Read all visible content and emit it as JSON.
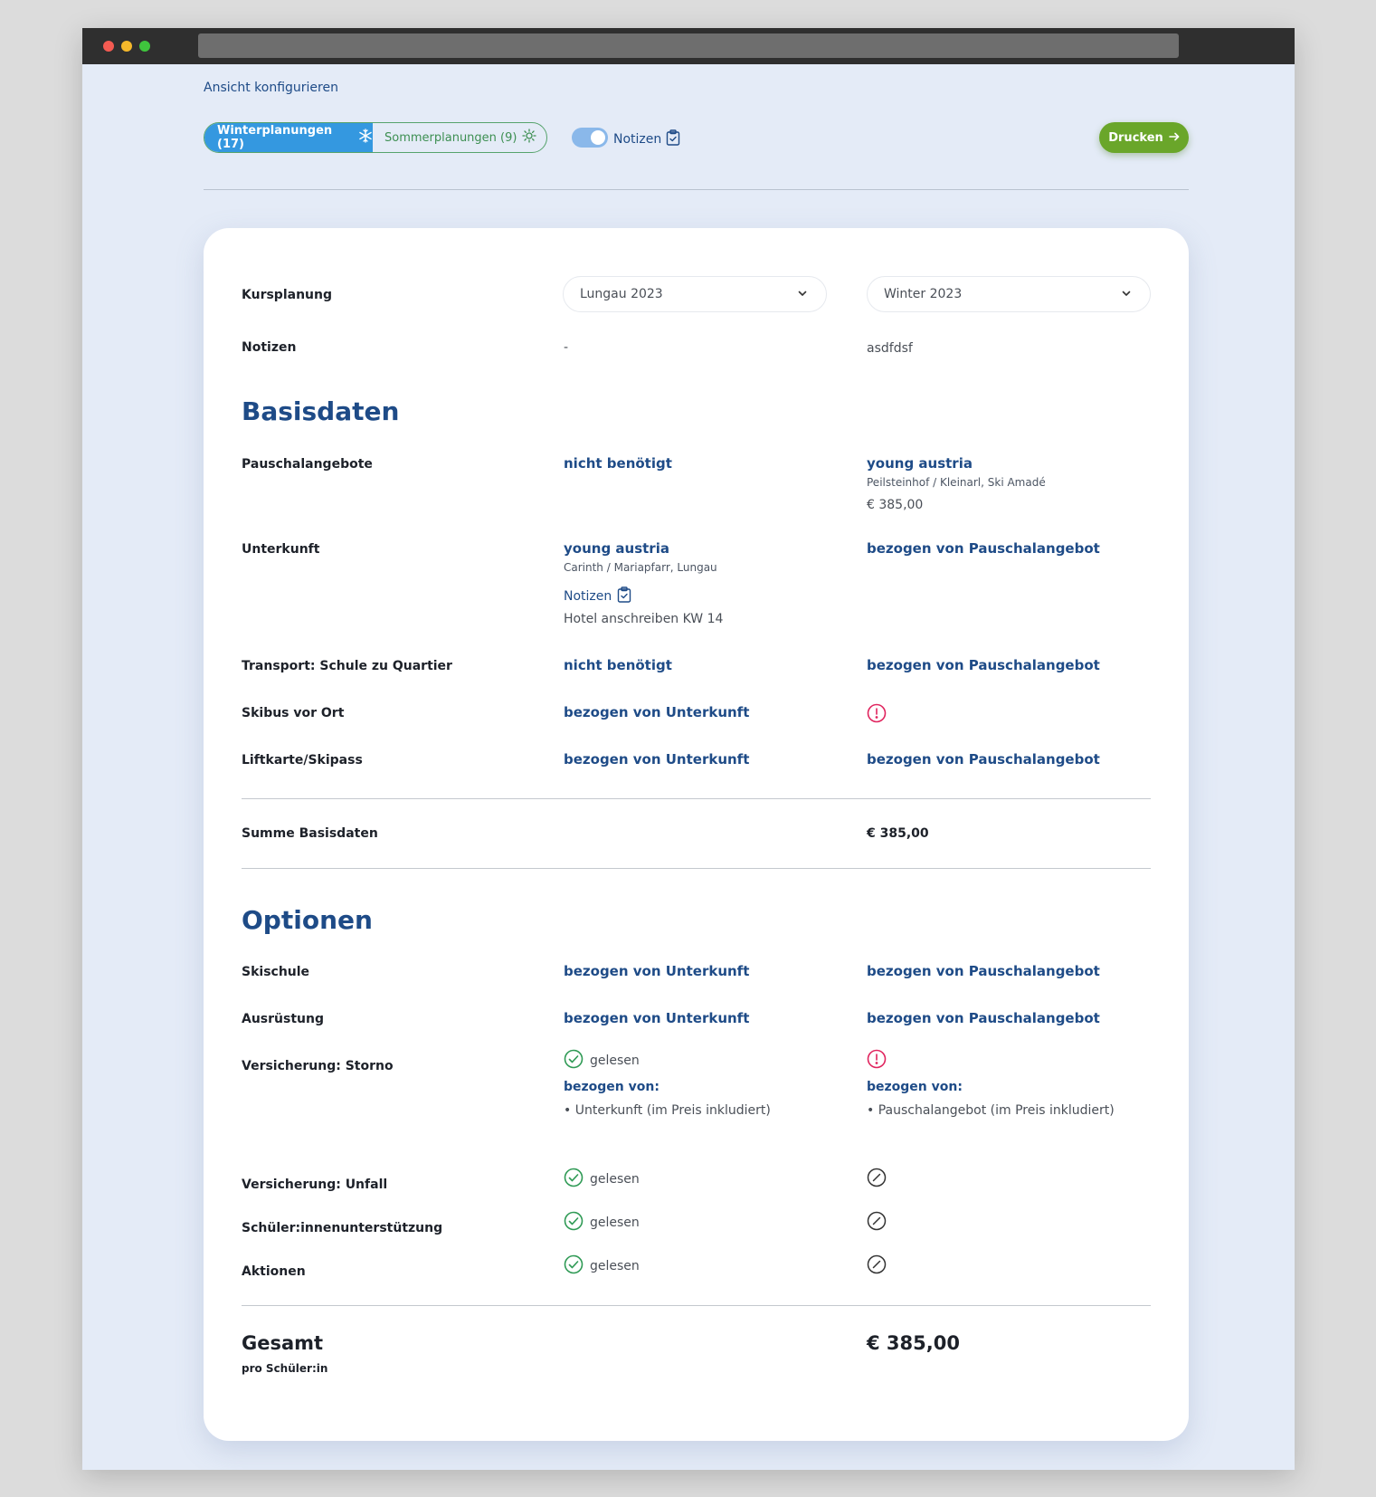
{
  "colors": {
    "accent": "#1e4b87",
    "winter": "#3498e0",
    "summer": "#3d8f52",
    "print": "#6aa62a",
    "alert": "#e0245e",
    "ok": "#2f9a55"
  },
  "header": {
    "config_link": "Ansicht konfigurieren",
    "winter_tab": "Winterplanungen (17)",
    "winter_icon": "snowflake-icon",
    "summer_tab": "Sommerplanungen (9)",
    "summer_icon": "sun-icon",
    "notes_toggle_label": "Notizen",
    "notes_toggle_on": true,
    "print_label": "Drucken"
  },
  "rows": {
    "kursplanung": {
      "label": "Kursplanung",
      "col1": "Lungau 2023",
      "col2": "Winter 2023"
    },
    "notizen": {
      "label": "Notizen",
      "col1": "-",
      "col2": "asdfdsf"
    }
  },
  "basisdaten": {
    "title": "Basisdaten",
    "pauschal": {
      "label": "Pauschalangebote",
      "col1": "nicht benötigt",
      "col2_title": "young austria",
      "col2_sub": "Peilsteinhof / Kleinarl, Ski Amadé",
      "col2_price": "€ 385,00"
    },
    "unterkunft": {
      "label": "Unterkunft",
      "col1_title": "young austria",
      "col1_sub": "Carinth / Mariapfarr, Lungau",
      "col1_note_label": "Notizen",
      "col1_note": "Hotel anschreiben KW 14",
      "col2": "bezogen von Pauschalangebot"
    },
    "transport": {
      "label": "Transport: Schule zu Quartier",
      "col1": "nicht benötigt",
      "col2": "bezogen von Pauschalangebot"
    },
    "skibus": {
      "label": "Skibus vor Ort",
      "col1": "bezogen von Unterkunft",
      "col2_icon": "alert-icon"
    },
    "liftkarte": {
      "label": "Liftkarte/Skipass",
      "col1": "bezogen von Unterkunft",
      "col2": "bezogen von Pauschalangebot"
    },
    "summe": {
      "label": "Summe Basisdaten",
      "col2": "€ 385,00"
    }
  },
  "optionen": {
    "title": "Optionen",
    "skischule": {
      "label": "Skischule",
      "col1": "bezogen von Unterkunft",
      "col2": "bezogen von Pauschalangebot"
    },
    "ausruestung": {
      "label": "Ausrüstung",
      "col1": "bezogen von Unterkunft",
      "col2": "bezogen von Pauschalangebot"
    },
    "storno": {
      "label": "Versicherung: Storno",
      "col1_status": "gelesen",
      "col1_from": "bezogen von:",
      "col1_item": "Unterkunft (im Preis inkludiert)",
      "col2_from": "bezogen von:",
      "col2_item": "Pauschalangebot (im Preis inkludiert)"
    },
    "unfall": {
      "label": "Versicherung: Unfall",
      "col1_status": "gelesen"
    },
    "support": {
      "label": "Schüler:innenunterstützung",
      "col1_status": "gelesen"
    },
    "aktionen": {
      "label": "Aktionen",
      "col1_status": "gelesen"
    }
  },
  "gesamt": {
    "label": "Gesamt",
    "sub": "pro Schüler:in",
    "col2": "€ 385,00"
  }
}
